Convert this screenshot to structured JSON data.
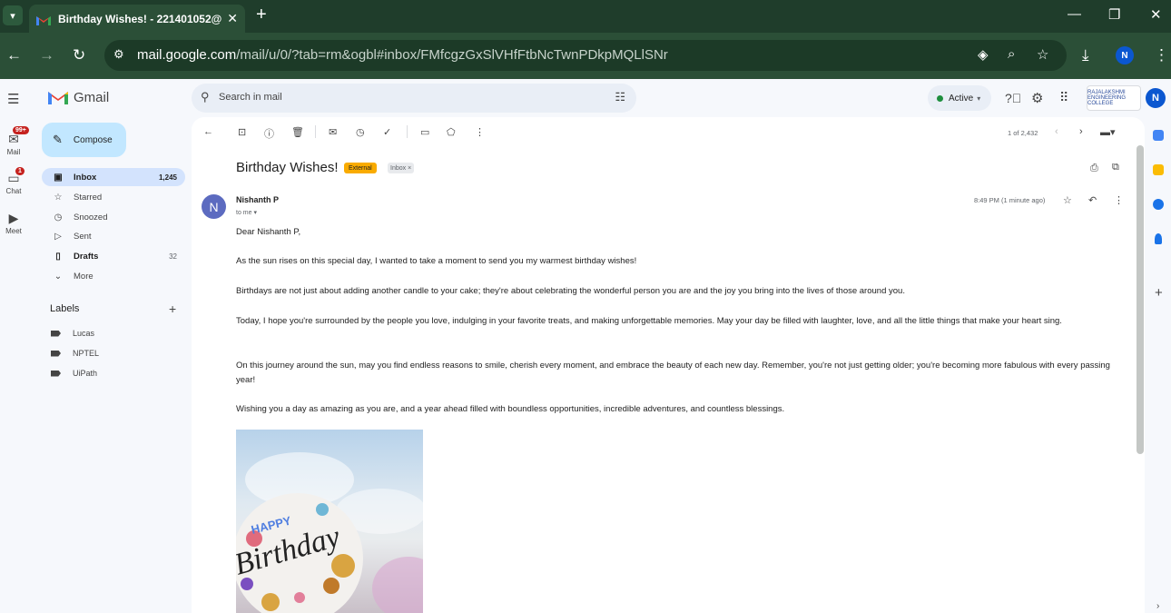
{
  "browser": {
    "tab_title": "Birthday Wishes! - 221401052@",
    "url_host": "mail.google.com",
    "url_path": "/mail/u/0/?tab=rm&ogbl#inbox/FMfcgzGxSlVHfFtbNcTwnPDkpMQLlSNr",
    "profile_initial": "N"
  },
  "rail": {
    "mail": {
      "label": "Mail",
      "badge": "99+"
    },
    "chat": {
      "label": "Chat",
      "badge": "1"
    },
    "meet": {
      "label": "Meet"
    }
  },
  "header": {
    "app_name": "Gmail",
    "search_placeholder": "Search in mail",
    "status": "Active",
    "org_name": "RAJALAKSHMI ENGINEERING COLLEGE",
    "account_initial": "N"
  },
  "sidebar": {
    "compose": "Compose",
    "items": [
      {
        "label": "Inbox",
        "count": "1,245",
        "icon": "inbox-icon",
        "selected": true
      },
      {
        "label": "Starred",
        "count": "",
        "icon": "star-icon"
      },
      {
        "label": "Snoozed",
        "count": "",
        "icon": "clock-icon"
      },
      {
        "label": "Sent",
        "count": "",
        "icon": "send-icon"
      },
      {
        "label": "Drafts",
        "count": "32",
        "icon": "draft-icon"
      },
      {
        "label": "More",
        "count": "",
        "icon": "chevron-down-icon"
      }
    ],
    "labels_title": "Labels",
    "labels": [
      "Lucas",
      "NPTEL",
      "UiPath"
    ]
  },
  "toolbar": {
    "pager": "1 of 2,432"
  },
  "message": {
    "subject": "Birthday Wishes!",
    "badge_external": "External",
    "badge_inbox": "Inbox ×",
    "sender_initial": "N",
    "sender": "Nishanth P",
    "to": "to me ▾",
    "time": "8:49 PM (1 minute ago)",
    "paragraphs": [
      "Dear Nishanth P,",
      "As the sun rises on this special day, I wanted to take a moment to send you my warmest birthday wishes!",
      "Birthdays are not just about adding another candle to your cake; they're about celebrating the wonderful person you are and the joy you bring into the lives of those around you.",
      "Today, I hope you're surrounded by the people you love, indulging in your favorite treats, and making unforgettable memories. May your day be filled with laughter, love, and all the little things that make your heart sing.",
      "On this journey around the sun, may you find endless reasons to smile, cherish every moment, and embrace the beauty of each new day. Remember, you're not just getting older; you're becoming more fabulous with every passing year!",
      "Wishing you a day as amazing as you are, and a year ahead filled with boundless opportunities, incredible adventures, and countless blessings."
    ],
    "image_text_top": "HAPPY",
    "image_text_main": "Birthday"
  }
}
